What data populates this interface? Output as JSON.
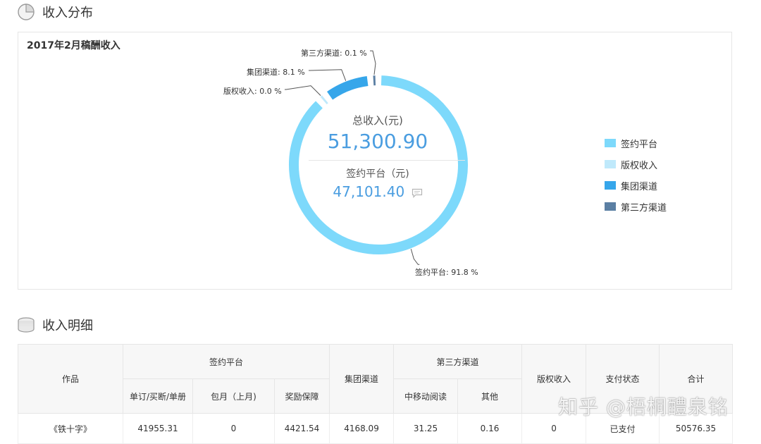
{
  "sections": {
    "distribution_title": "收入分布",
    "detail_title": "收入明细"
  },
  "chart_data": {
    "type": "pie",
    "title": "2017年2月稿酬收入",
    "slices": [
      {
        "name": "签约平台",
        "percent": 91.8,
        "color": "#7dd9fb"
      },
      {
        "name": "版权收入",
        "percent": 0.0,
        "color": "#bfe9fb"
      },
      {
        "name": "集团渠道",
        "percent": 8.1,
        "color": "#36a6ea"
      },
      {
        "name": "第三方渠道",
        "percent": 0.1,
        "color": "#5b7fa3"
      }
    ],
    "callouts": [
      {
        "label": "签约平台: 91.8 %"
      },
      {
        "label": "版权收入: 0.0 %"
      },
      {
        "label": "集团渠道: 8.1 %"
      },
      {
        "label": "第三方渠道: 0.1 %"
      }
    ],
    "center": {
      "total_label": "总收入(元)",
      "total_value": "51,300.90",
      "sub_label": "签约平台（元)",
      "sub_value": "47,101.40"
    },
    "legend": [
      "签约平台",
      "版权收入",
      "集团渠道",
      "第三方渠道"
    ],
    "legend_placement": "right"
  },
  "table": {
    "headers": {
      "work": "作品",
      "sign_platform": "签约平台",
      "group_channel": "集团渠道",
      "third_party": "第三方渠道",
      "copyright": "版权收入",
      "pay_status": "支付状态",
      "total": "合计",
      "sub_order": "单订/买断/单册",
      "sub_monthly": "包月（上月)",
      "sub_reward": "奖励保障",
      "sub_cmread": "中移动阅读",
      "sub_other": "其他"
    },
    "rows": [
      {
        "work": "《铁十字》",
        "order": "41955.31",
        "monthly": "0",
        "reward": "4421.54",
        "group": "4168.09",
        "cmread": "31.25",
        "other": "0.16",
        "copyright": "0",
        "status": "已支付",
        "total": "50576.35"
      }
    ]
  },
  "watermark": "知乎 @梧桐醴泉铭"
}
